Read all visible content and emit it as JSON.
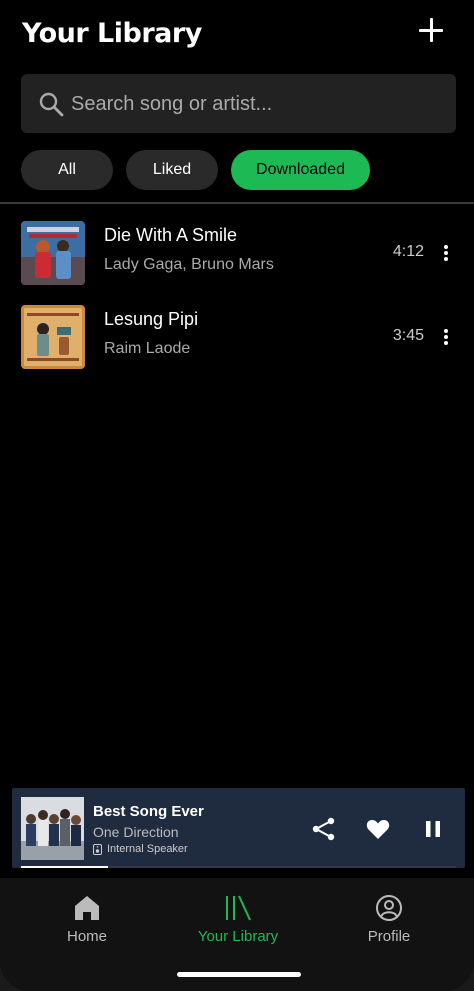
{
  "header": {
    "title": "Your Library",
    "add_icon": "plus-icon"
  },
  "search": {
    "placeholder": "Search song or artist...",
    "value": "",
    "icon": "search-icon"
  },
  "filters": [
    {
      "label": "All",
      "selected": false
    },
    {
      "label": "Liked",
      "selected": false
    },
    {
      "label": "Downloaded",
      "selected": true
    }
  ],
  "songs": [
    {
      "title": "Die With A Smile",
      "artist": "Lady Gaga, Bruno Mars",
      "duration": "4:12"
    },
    {
      "title": "Lesung Pipi",
      "artist": "Raim Laode",
      "duration": "3:45"
    }
  ],
  "now_playing": {
    "title": "Best Song Ever",
    "artist": "One Direction",
    "device": "Internal Speaker",
    "progress": 0.2,
    "icons": [
      "share-icon",
      "heart-icon",
      "pause-icon"
    ]
  },
  "nav": [
    {
      "label": "Home",
      "icon": "home-icon",
      "active": false
    },
    {
      "label": "Your Library",
      "icon": "library-icon",
      "active": true
    },
    {
      "label": "Profile",
      "icon": "profile-icon",
      "active": false
    }
  ],
  "colors": {
    "accent": "#1db954",
    "player_bg": "#1f2b3f",
    "background": "#000000"
  }
}
